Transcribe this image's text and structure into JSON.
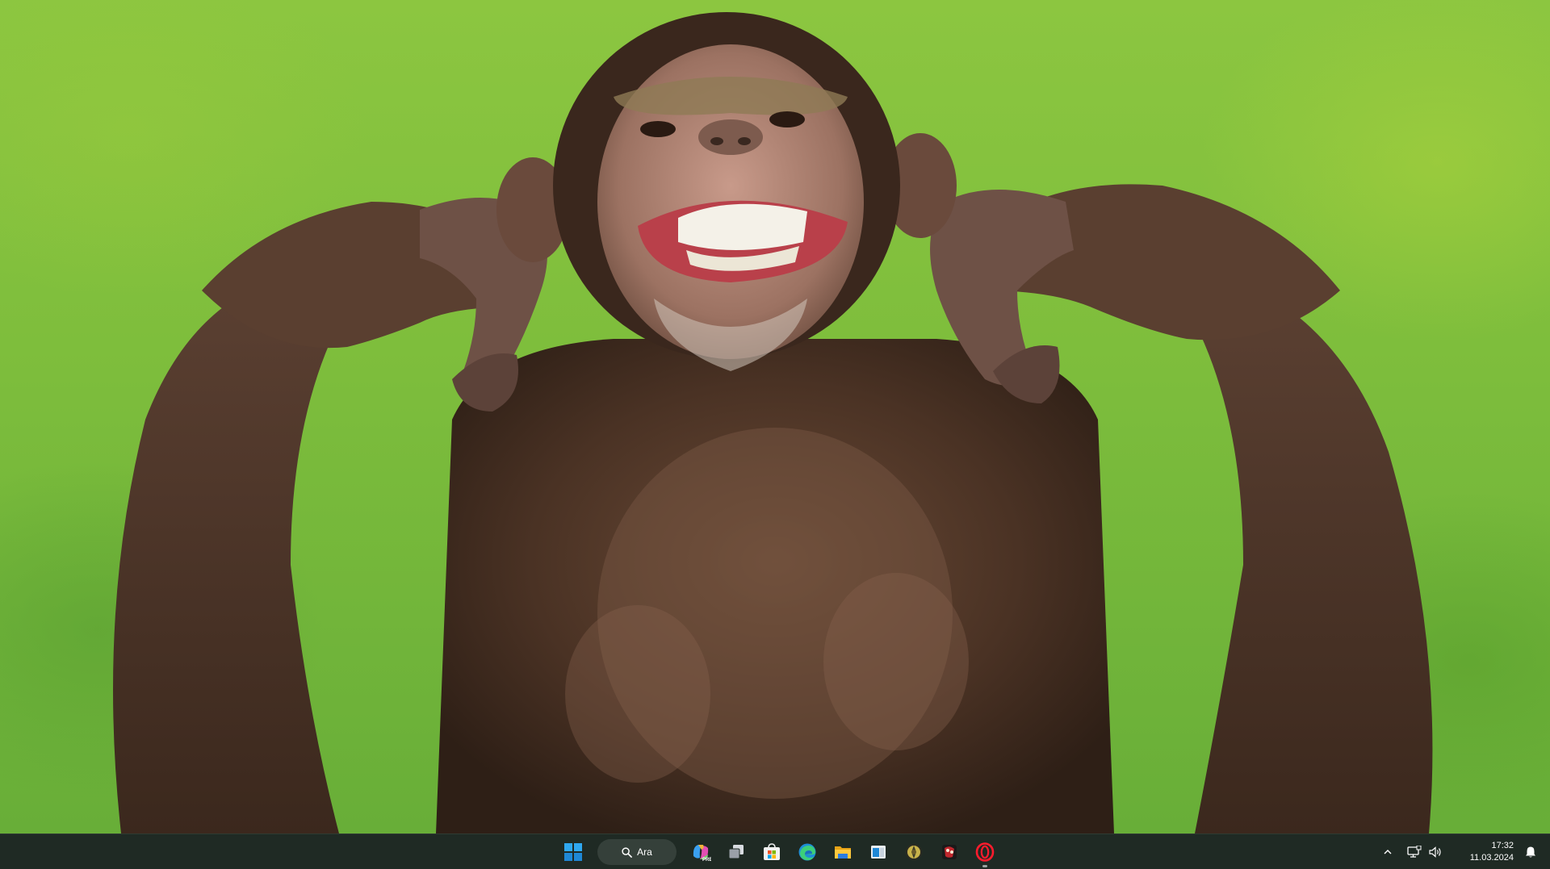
{
  "taskbar": {
    "search": {
      "label": "Ara"
    },
    "pinned": [
      {
        "name": "copilot-icon",
        "running": false
      },
      {
        "name": "task-view-icon",
        "running": false
      },
      {
        "name": "microsoft-store-icon",
        "running": false
      },
      {
        "name": "edge-icon",
        "running": false
      },
      {
        "name": "file-explorer-icon",
        "running": false
      },
      {
        "name": "app-window-icon",
        "running": false
      },
      {
        "name": "game-app-icon",
        "running": false
      },
      {
        "name": "media-app-icon",
        "running": false
      },
      {
        "name": "opera-icon",
        "running": true
      }
    ],
    "tray": {
      "overflow_icon": "chevron-up-icon",
      "network_icon": "network-icon",
      "volume_icon": "volume-icon",
      "notification_icon": "bell-icon"
    },
    "clock": {
      "time": "17:32",
      "date": "11.03.2024"
    }
  },
  "colors": {
    "taskbar_bg": "#1f2a24",
    "wallpaper_green": "#7dbd3c",
    "accent_blue": "#0a84d8"
  }
}
